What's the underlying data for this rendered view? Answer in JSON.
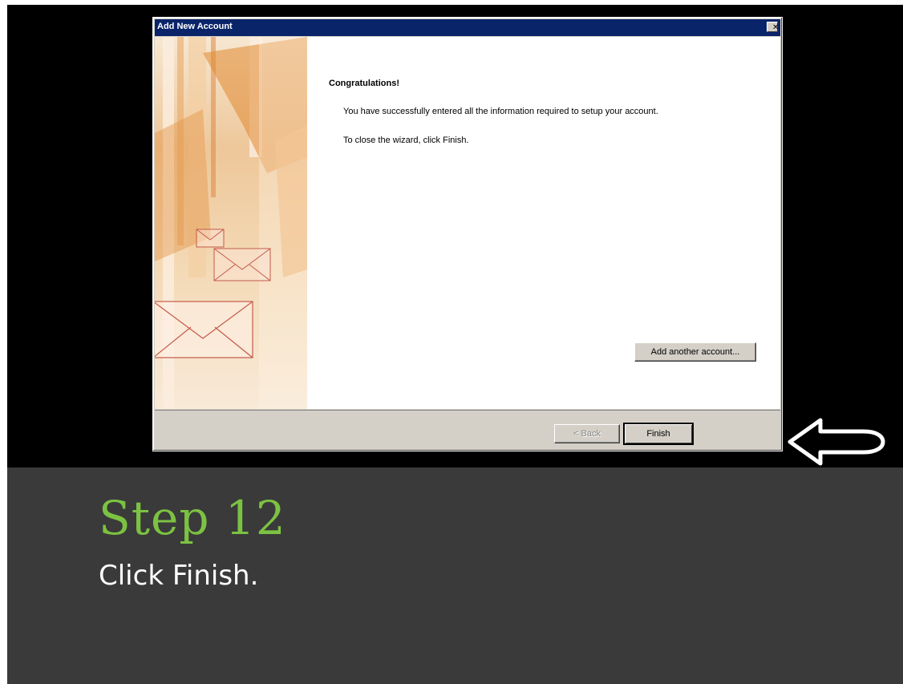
{
  "dialog": {
    "title": "Add New Account",
    "close_glyph": "✕",
    "heading": "Congratulations!",
    "message_success": "You have successfully entered all the information required to setup your account.",
    "message_close": "To close the wizard, click Finish.",
    "add_another_label": "Add another account...",
    "back_label": "< Back",
    "finish_label": "Finish"
  },
  "slide": {
    "step_title": "Step 12",
    "step_instruction": "Click Finish."
  },
  "colors": {
    "titlebar": "#0a246a",
    "step_title": "#7cc242",
    "band": "#3a3a3a",
    "dialog_face": "#d4d0c8"
  },
  "icons": {
    "close": "close-icon",
    "pointer": "left-arrow-icon",
    "envelope": "envelope-icon"
  }
}
